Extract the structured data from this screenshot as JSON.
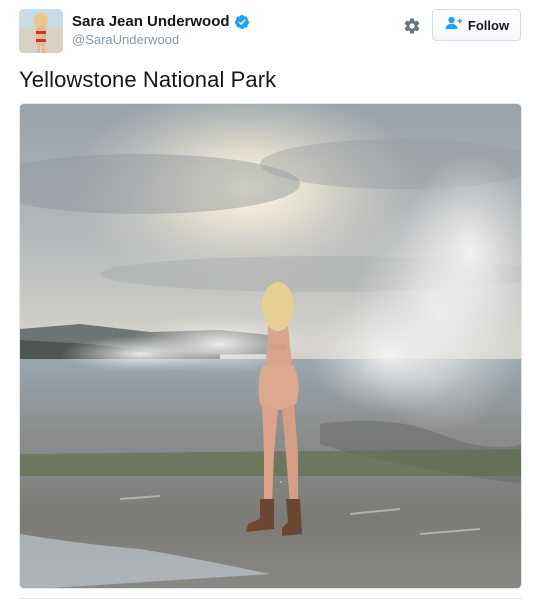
{
  "header": {
    "display_name": "Sara Jean Underwood",
    "handle": "@SaraUnderwood",
    "verified": true,
    "gear_icon": "gear-icon",
    "follow_label": "Follow",
    "follow_icon": "add-user-icon"
  },
  "tweet": {
    "text": "Yellowstone National Park",
    "media": "photo"
  },
  "colors": {
    "text": "#14171a",
    "secondary": "#8899a6",
    "verified": "#1da1f2",
    "border": "#e1e8ed"
  }
}
